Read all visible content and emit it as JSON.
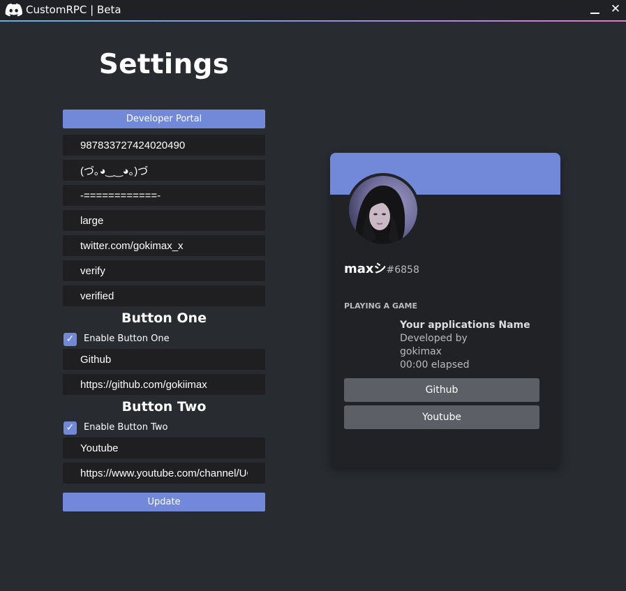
{
  "window": {
    "title": "CustomRPC | Beta",
    "logo_icon": "discord-logo-icon",
    "minimize_icon": "minimize-icon",
    "close_icon": "close-icon",
    "close_glyph": "✕"
  },
  "settings": {
    "title": "Settings",
    "developer_portal_label": "Developer Portal",
    "fields": {
      "client_id": "987833727424020490",
      "details": "(づ｡◕‿‿◕｡)づ",
      "state": "-============-",
      "large_image": "large",
      "large_text": "twitter.com/gokimax_x",
      "small_image": "verify",
      "small_text": "verified"
    },
    "button_one": {
      "heading": "Button One",
      "enable_label": "Enable Button One",
      "enabled": true,
      "label_value": "Github",
      "url_value": "https://github.com/gokiimax"
    },
    "button_two": {
      "heading": "Button Two",
      "enable_label": "Enable Button Two",
      "enabled": true,
      "label_value": "Youtube",
      "url_value": "https://www.youtube.com/channel/UC"
    },
    "update_label": "Update",
    "check_glyph": "✓"
  },
  "preview": {
    "username": "maxシ",
    "discriminator": "#6858",
    "activity_header": "PLAYING A GAME",
    "app_name": "Your applications Name",
    "line1": "Developed by",
    "line2": "gokimax",
    "elapsed": "00:00 elapsed",
    "button1_label": "Github",
    "button2_label": "Youtube"
  },
  "colors": {
    "accent": "#7289da",
    "background": "#282b30",
    "input_bg": "#1f1f21",
    "card_bg": "#202225",
    "card_button": "#5c6066"
  }
}
